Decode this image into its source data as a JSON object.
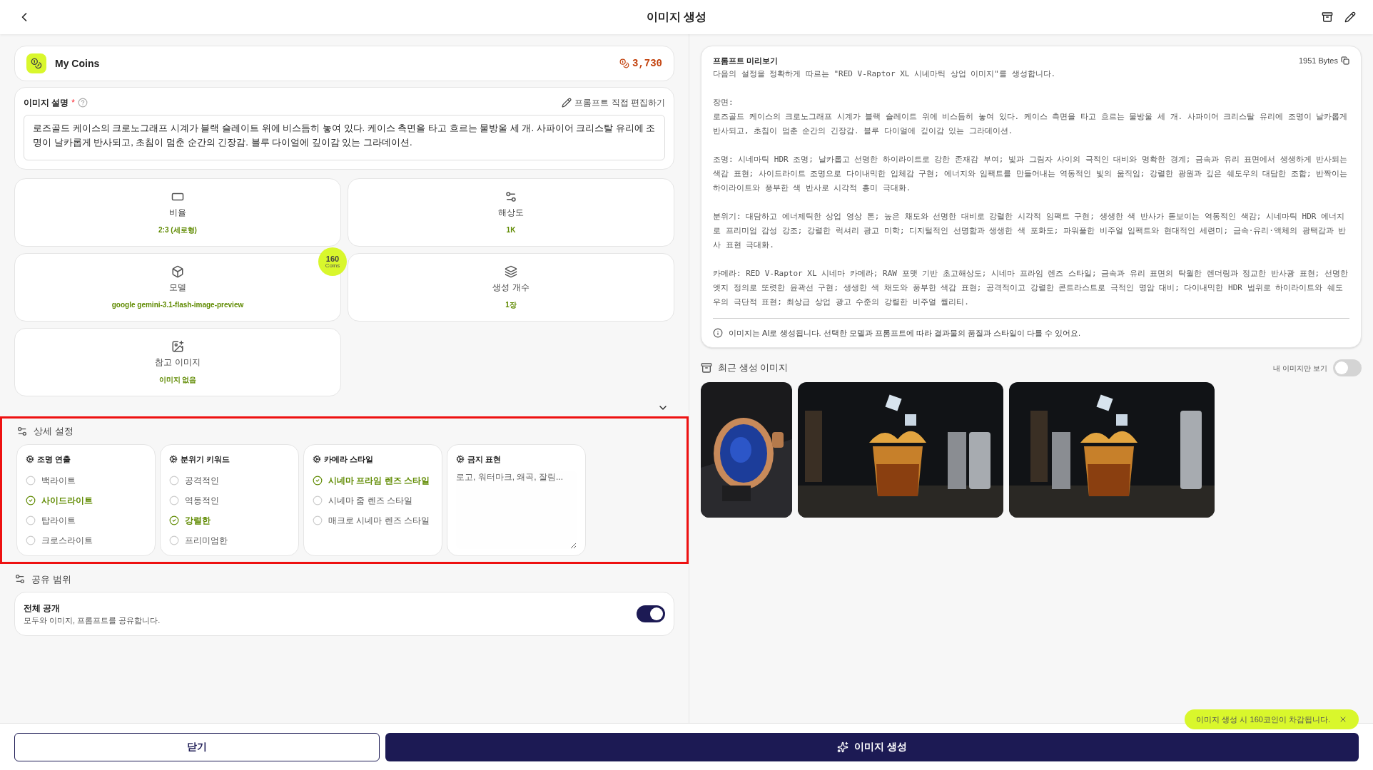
{
  "header": {
    "title": "이미지 생성"
  },
  "coins": {
    "label": "My Coins",
    "amount": "3,730"
  },
  "description": {
    "label": "이미지 설명",
    "required": "*",
    "edit_link": "프롬프트 직접 편집하기",
    "value": "로즈골드 케이스의 크로노그래프 시계가 블랙 슬레이트 위에 비스듬히 놓여 있다. 케이스 측면을 타고 흐르는 물방울 세 개. 사파이어 크리스탈 유리에 조명이 날카롭게 반사되고, 초침이 멈춘 순간의 긴장감. 블루 다이얼에 깊이감 있는 그라데이션."
  },
  "options": [
    {
      "kind": "ratio",
      "label": "비율",
      "value": "2:3 (세로형)"
    },
    {
      "kind": "resolution",
      "label": "해상도",
      "value": "1K"
    },
    {
      "kind": "model",
      "label": "모델",
      "value": "google gemini-3.1-flash-image-preview",
      "badge": {
        "amount": "160",
        "unit": "Coins"
      }
    },
    {
      "kind": "count",
      "label": "생성 개수",
      "value": "1장"
    },
    {
      "kind": "reference",
      "label": "참고 이미지",
      "value": "이미지 없음"
    }
  ],
  "detail_settings": {
    "title": "상세 설정",
    "groups": [
      {
        "kind": "radio",
        "title": "조명 연출",
        "options": [
          {
            "label": "백라이트",
            "selected": false
          },
          {
            "label": "사이드라이트",
            "selected": true
          },
          {
            "label": "탑라이트",
            "selected": false
          },
          {
            "label": "크로스라이트",
            "selected": false
          }
        ]
      },
      {
        "kind": "radio",
        "title": "분위기 키워드",
        "options": [
          {
            "label": "공격적인",
            "selected": false
          },
          {
            "label": "역동적인",
            "selected": false
          },
          {
            "label": "강렬한",
            "selected": true
          },
          {
            "label": "프리미엄한",
            "selected": false
          }
        ]
      },
      {
        "kind": "radio",
        "title": "카메라 스타일",
        "options": [
          {
            "label": "시네마 프라임 렌즈 스타일",
            "selected": true
          },
          {
            "label": "시네마 줌 렌즈 스타일",
            "selected": false
          },
          {
            "label": "매크로 시네마 렌즈 스타일",
            "selected": false
          }
        ]
      },
      {
        "kind": "text",
        "title": "금지 표현",
        "placeholder": "로고, 워터마크, 왜곡, 잘림..."
      }
    ]
  },
  "share": {
    "title": "공유 범위",
    "setting": {
      "title": "전체 공개",
      "description": "모두와 이미지, 프롬프트를 공유합니다.",
      "on": true
    }
  },
  "preview": {
    "title": "프롬프트 미리보기",
    "bytes": "1951 Bytes",
    "blocks": [
      [
        "다음의 설정을 정확하게 따르는 \"RED V-Raptor XL 시네마틱 상업 이미지\"를 생성합니다."
      ],
      [
        "장면:",
        "로즈골드 케이스의 크로노그래프 시계가 블랙 슬레이트 위에 비스듬히 놓여 있다. 케이스 측면을 타고 흐르는 물방울 세 개. 사파이어 크리스탈 유리에 조명이 날카롭게 반사되고, 초침이 멈춘 순간의 긴장감. 블루 다이얼에 깊이감 있는 그라데이션."
      ],
      [
        "조명: 시네마틱 HDR 조명; 날카롭고 선명한 하이라이트로 강한 존재감 부여; 빛과 그림자 사이의 극적인 대비와 명확한 경계; 금속과 유리 표면에서 생생하게 반사되는 색감 표현; 사이드라이트 조명으로 다이내믹한 입체감 구현; 에너지와 임팩트를 만들어내는 역동적인 빛의 움직임; 강렬한 광원과 깊은 쉐도우의 대담한 조합; 반짝이는 하이라이트와 풍부한 색 반사로 시각적 흥미 극대화."
      ],
      [
        "분위기: 대담하고 에너제틱한 상업 영상 톤; 높은 채도와 선명한 대비로 강렬한 시각적 임팩트 구현; 생생한 색 반사가 돋보이는 역동적인 색감; 시네마틱 HDR 에너지로 프리미엄 감성 강조; 강렬한 럭셔리 광고 미학; 디지털적인 선명함과 생생한 색 포화도; 파워풀한 비주얼 임팩트와 현대적인 세련미; 금속·유리·액체의 광택감과 반사 표현 극대화."
      ],
      [
        "카메라: RED V-Raptor XL 시네마 카메라; RAW 포맷 기반 초고해상도; 시네마 프라임 렌즈 스타일; 금속과 유리 표면의 탁월한 렌더링과 정교한 반사광 표현; 선명한 엣지 정의로 또렷한 윤곽선 구현; 생생한 색 채도와 풍부한 색감 표현; 공격적이고 강렬한 콘트라스트로 극적인 명암 대비; 다이내믹한 HDR 범위로 하이라이트와 쉐도우의 극단적 표현; 최상급 상업 광고 수준의 강렬한 비주얼 퀄리티."
      ]
    ],
    "notice": "이미지는 AI로 생성됩니다. 선택한 모델과 프롬프트에 따라 결과물의 품질과 스타일이 다를 수 있어요."
  },
  "recent": {
    "title": "최근 생성 이미지",
    "mine_only": {
      "label": "내 이미지만 보기",
      "on": false
    }
  },
  "footer": {
    "close": "닫기",
    "generate": "이미지 생성",
    "tooltip": "이미지 생성 시 160코인이 차감됩니다."
  }
}
